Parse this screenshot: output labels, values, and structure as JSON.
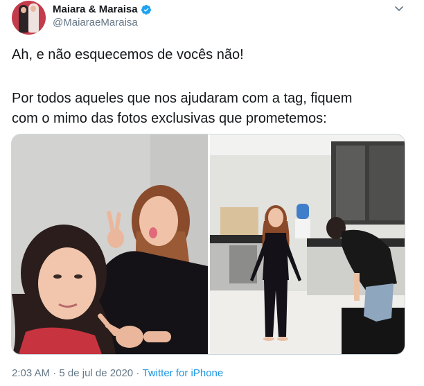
{
  "author": {
    "display_name": "Maiara & Maraisa",
    "handle": "@MaiaraeMaraisa",
    "verified": true
  },
  "tweet": {
    "line1": "Ah, e não esquecemos de vocês não!",
    "line2": "Por todos aqueles que nos ajudaram com a tag, fiquem",
    "line3": "com o mimo das fotos exclusivas que prometemos:"
  },
  "media": {
    "photo_count": 2
  },
  "footer": {
    "time": "2:03 AM",
    "separator1": " · ",
    "date": "5 de jul de 2020",
    "separator2": " · ",
    "source": "Twitter for iPhone"
  },
  "colors": {
    "verified": "#1da1f2",
    "link": "#1b95e0",
    "secondary_text": "#657786",
    "border": "#ccd6dd"
  },
  "icons": [
    "verified-badge-icon",
    "caret-down-icon"
  ]
}
